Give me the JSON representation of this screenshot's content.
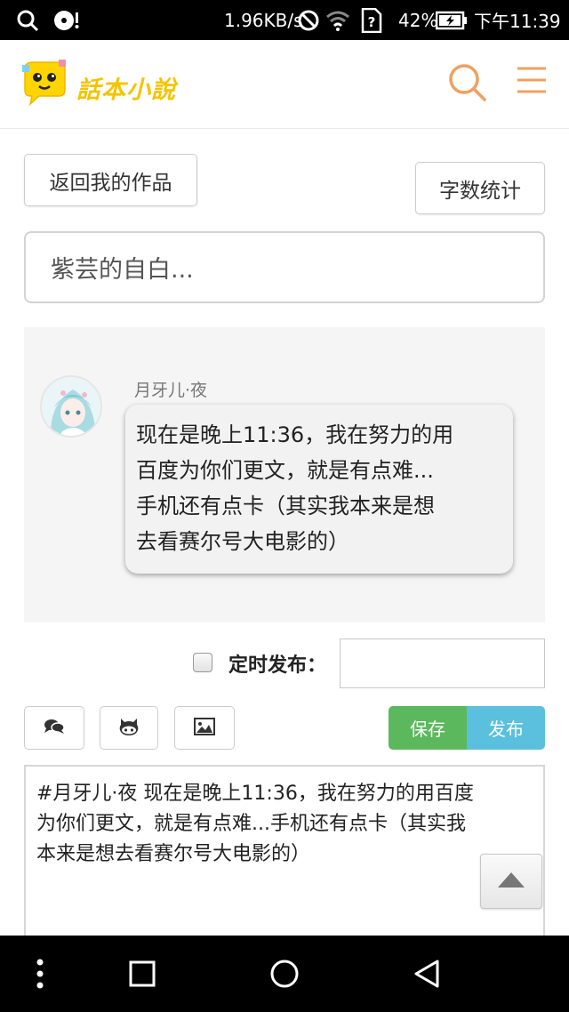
{
  "status_bar": {
    "speed": "1.96KB/s",
    "battery": "42%",
    "time": "下午11:39",
    "icons": [
      "search-icon",
      "music-icon",
      "no-disturb-icon",
      "wifi-icon",
      "sim-unknown-icon",
      "battery-charging-icon"
    ]
  },
  "header": {
    "logo_text": "話本小說"
  },
  "actions": {
    "back_label": "返回我的作品",
    "count_label": "字数统计"
  },
  "title_input": {
    "value": "紫芸的自白..."
  },
  "preview": {
    "nickname": "月牙儿·夜",
    "message_lines": [
      "现在是晚上11:36，我在努力的用",
      "百度为你们更文，就是有点难...",
      "手机还有点卡（其实我本来是想",
      "去看赛尔号大电影的）"
    ]
  },
  "schedule": {
    "label": "定时发布：",
    "value": ""
  },
  "toolbar": {
    "save_label": "保存",
    "publish_label": "发布"
  },
  "editor": {
    "lines": [
      "#月牙儿·夜 现在是晚上11:36，我在努力的用百度",
      "为你们更文，就是有点难...手机还有点卡（其实我",
      "本来是想去看赛尔号大电影的）"
    ]
  },
  "colors": {
    "save": "#5cb85c",
    "publish": "#5bc0de",
    "header_icons": "#f0a060",
    "logo": "#f4c400"
  }
}
